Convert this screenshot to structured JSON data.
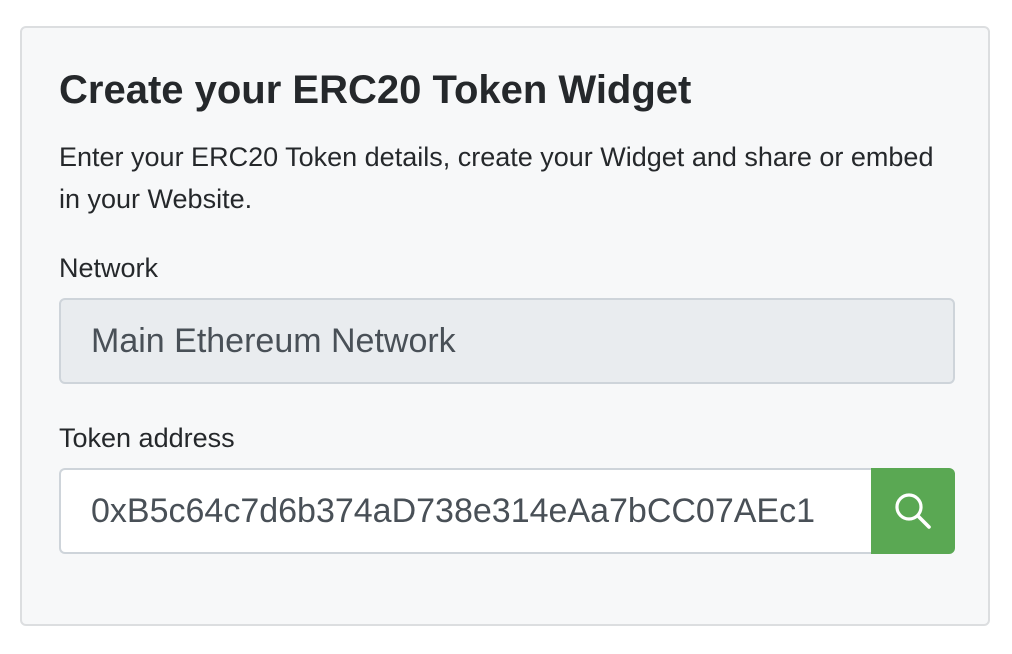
{
  "card": {
    "title": "Create your ERC20 Token Widget",
    "description": "Enter your ERC20 Token details, create your Widget and share or embed in your Website."
  },
  "network": {
    "label": "Network",
    "value": "Main Ethereum Network"
  },
  "token": {
    "label": "Token address",
    "value": "0xB5c64c7d6b374aD738e314eAa7bCC07AEc1"
  },
  "search_button": {
    "icon": "search-icon",
    "color": "#5aa853"
  }
}
